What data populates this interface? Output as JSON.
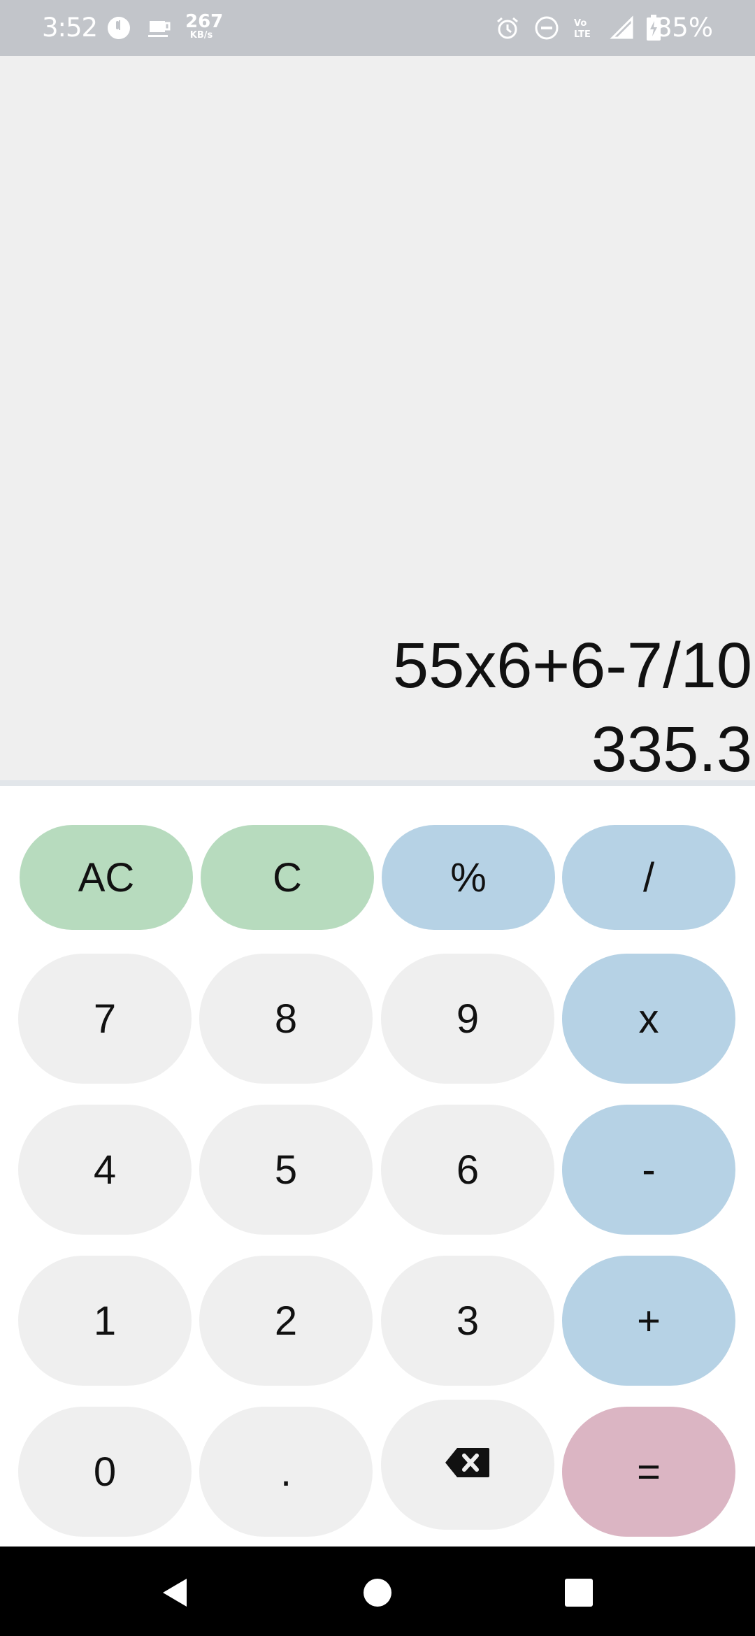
{
  "status_bar": {
    "time": "3:52",
    "speed_value": "267",
    "speed_unit": "KB/s",
    "battery": "85%",
    "icons": [
      "app-icon",
      "coffee-icon",
      "alarm-icon",
      "do-not-disturb-icon",
      "volte-icon",
      "signal-icon",
      "battery-icon"
    ]
  },
  "display": {
    "expression": "55x6+6-7/10",
    "result": "335.3"
  },
  "keys": {
    "ac": "AC",
    "c": "C",
    "percent": "%",
    "divide": "/",
    "seven": "7",
    "eight": "8",
    "nine": "9",
    "multiply": "x",
    "four": "4",
    "five": "5",
    "six": "6",
    "minus": "-",
    "one": "1",
    "two": "2",
    "three": "3",
    "plus": "+",
    "zero": "0",
    "dot": ".",
    "equals": "="
  },
  "colors": {
    "status_bar": "#c2c5ca",
    "display_bg": "#efefef",
    "clear_keys": "#b7dbbe",
    "operator_keys": "#b6d2e5",
    "digit_keys": "#efefef",
    "equals_key": "#dbb5c3",
    "nav_bar": "#000000"
  }
}
